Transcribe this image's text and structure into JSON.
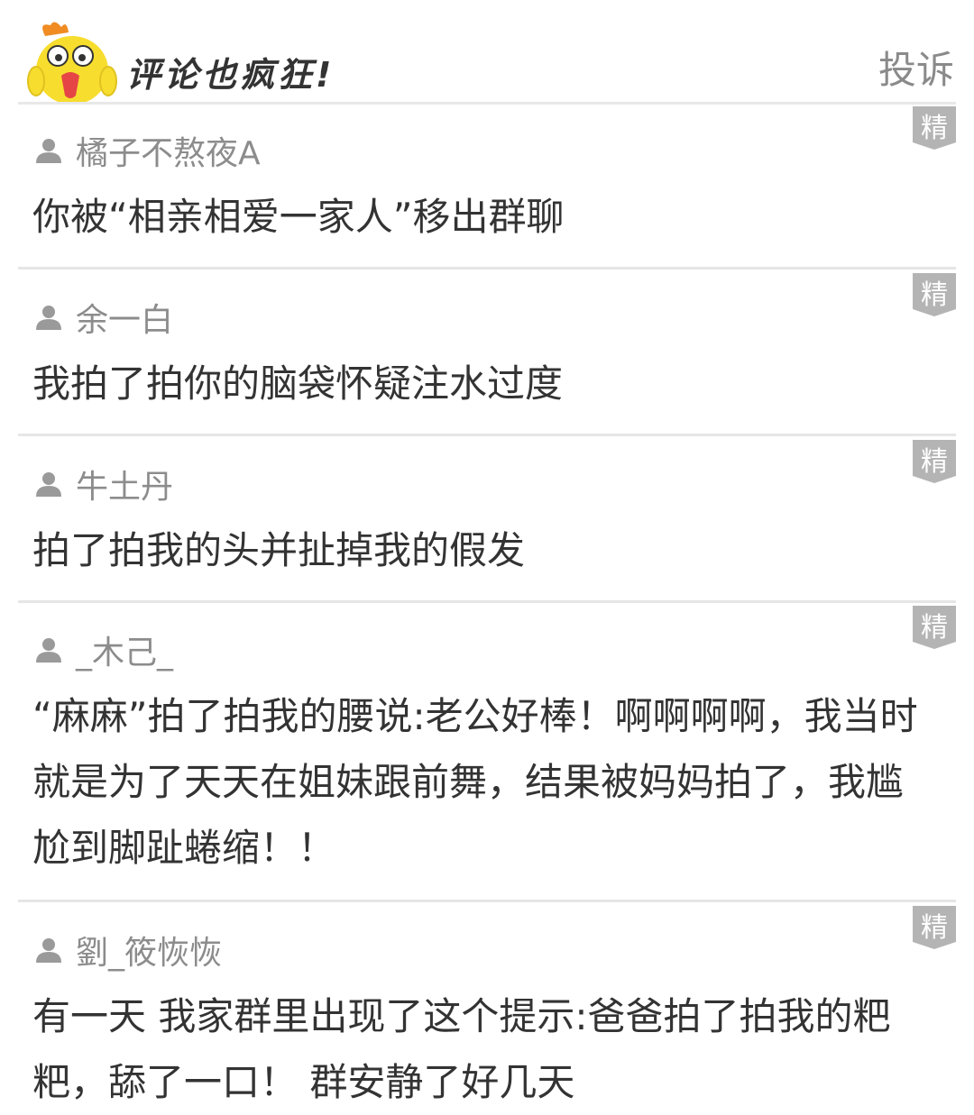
{
  "header": {
    "title": "评论也疯狂!",
    "report_label": "投诉"
  },
  "badge_label": "精",
  "colors": {
    "badge_bg": "#b4b4b4",
    "divider": "#e6e6e6",
    "username": "#8c8c8c",
    "text": "#333333"
  },
  "comments": [
    {
      "username": "橘子不熬夜A",
      "text": "你被“相亲相爱一家人”移出群聊"
    },
    {
      "username": "余一白",
      "text": "我拍了拍你的脑袋怀疑注水过度"
    },
    {
      "username": "牛土丹",
      "text": "拍了拍我的头并扯掉我的假发"
    },
    {
      "username": "_木己_",
      "text": "“麻麻”拍了拍我的腰说:老公好棒！啊啊啊啊，我当时就是为了天天在姐妹跟前舞，结果被妈妈拍了，我尴尬到脚趾蜷缩！！"
    },
    {
      "username": "劉_筱恢恢",
      "text": "有一天 我家群里出现了这个提示:爸爸拍了拍我的粑粑，舔了一口！ 群安静了好几天"
    }
  ]
}
